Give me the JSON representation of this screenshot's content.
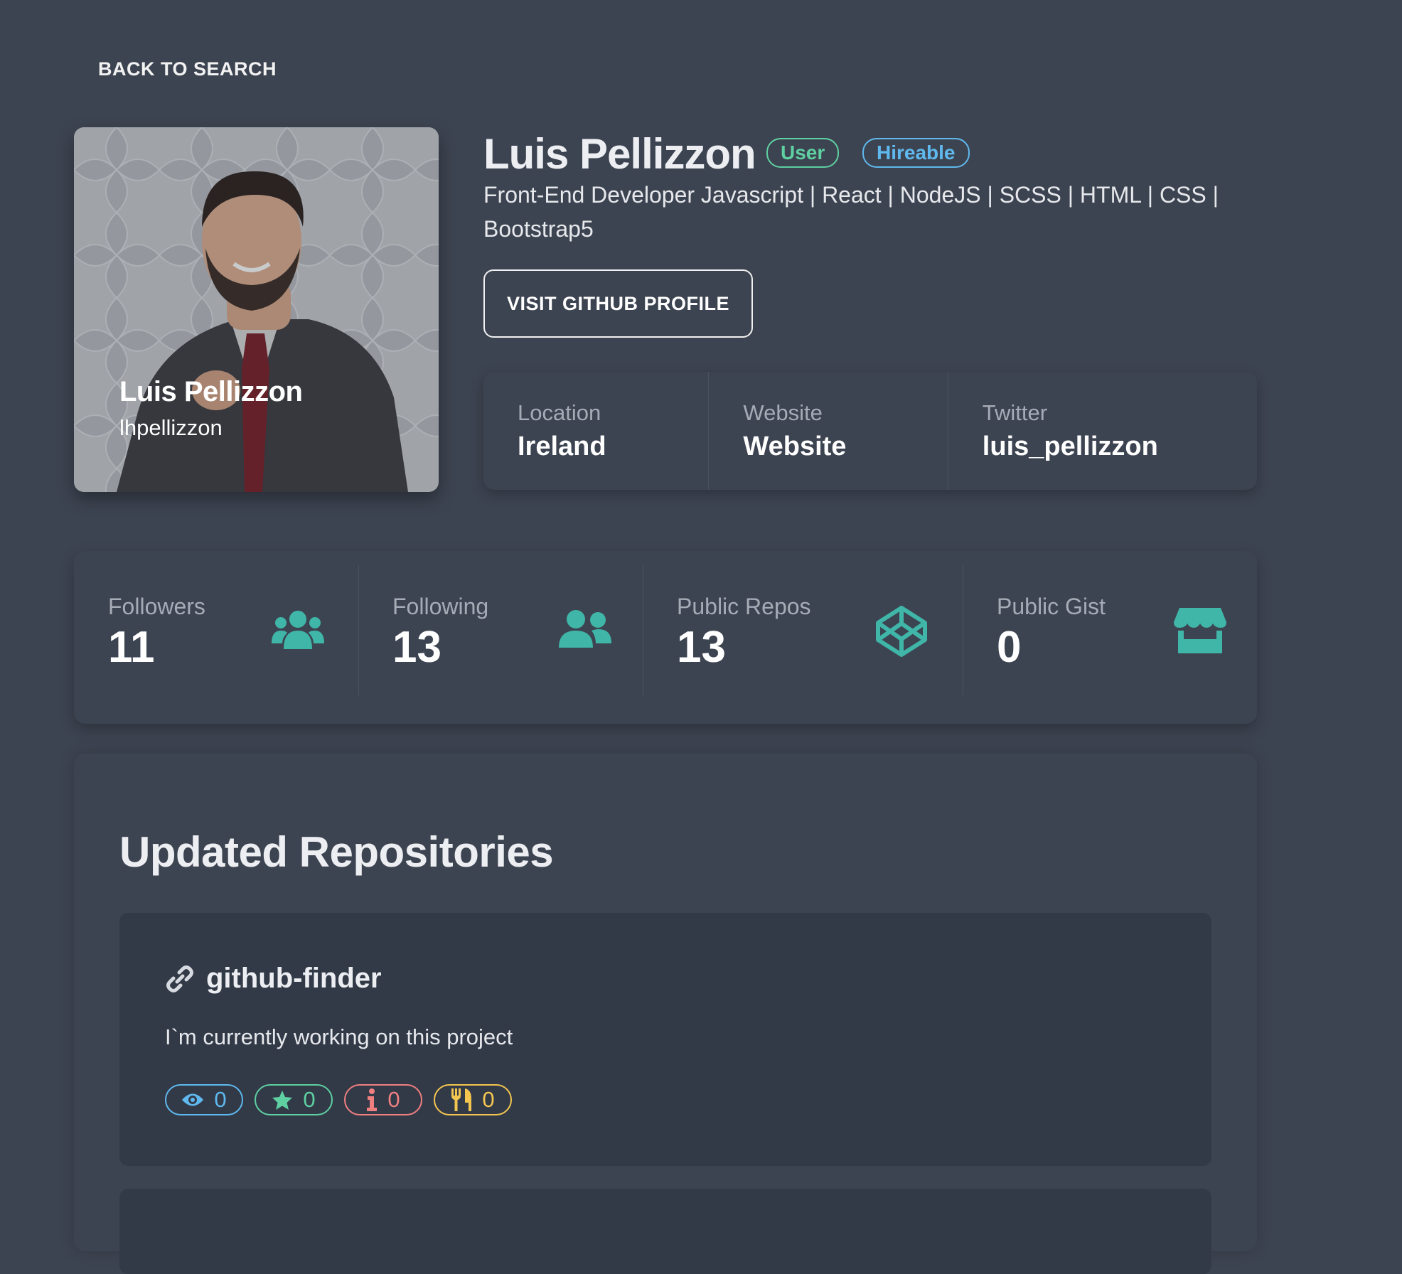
{
  "nav": {
    "back_label": "BACK TO SEARCH"
  },
  "profile": {
    "name": "Luis Pellizzon",
    "login": "lhpellizzon",
    "type_badge": "User",
    "hireable_badge": "Hireable",
    "bio": "Front-End Developer Javascript | React | NodeJS | SCSS | HTML | CSS | Bootstrap5",
    "visit_label": "VISIT GITHUB PROFILE"
  },
  "info": [
    {
      "label": "Location",
      "value": "Ireland"
    },
    {
      "label": "Website",
      "value": "Website"
    },
    {
      "label": "Twitter",
      "value": "luis_pellizzon"
    }
  ],
  "stats": [
    {
      "label": "Followers",
      "value": "11",
      "icon": "users-icon"
    },
    {
      "label": "Following",
      "value": "13",
      "icon": "user-friends-icon"
    },
    {
      "label": "Public Repos",
      "value": "13",
      "icon": "codepen-icon"
    },
    {
      "label": "Public Gist",
      "value": "0",
      "icon": "store-icon"
    }
  ],
  "repos_section": {
    "title": "Updated Repositories",
    "items": [
      {
        "name": "github-finder",
        "description": "I`m currently working on this project",
        "watchers": "0",
        "stars": "0",
        "issues": "0",
        "forks": "0"
      }
    ]
  },
  "colors": {
    "background": "#3d4451",
    "card": "#323a48",
    "accent": "#3fb6a8",
    "user_badge": "#5ed0a1",
    "hireable_badge": "#5fb9ee",
    "watchers": "#5fb9ee",
    "stars": "#5ed0a1",
    "issues": "#f07f7f",
    "forks": "#f5c64f"
  }
}
